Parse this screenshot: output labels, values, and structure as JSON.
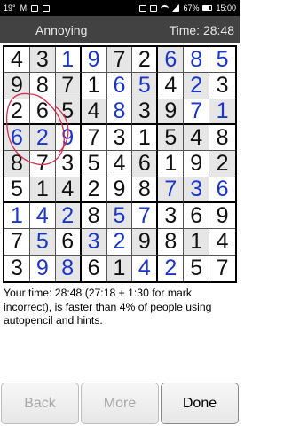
{
  "status_bar": {
    "left_indicators": [
      "19°",
      "M"
    ],
    "battery": "67%",
    "time": "15:00"
  },
  "header": {
    "difficulty": "Annoying",
    "timer": "Time: 28:48"
  },
  "board": {
    "rows": [
      [
        "4",
        "3",
        "1",
        "9",
        "7",
        "2",
        "6",
        "8",
        "5"
      ],
      [
        "9",
        "8",
        "7",
        "1",
        "6",
        "5",
        "4",
        "2",
        "3"
      ],
      [
        "2",
        "6",
        "5",
        "4",
        "8",
        "3",
        "9",
        "7",
        "1"
      ],
      [
        "6",
        "2",
        "9",
        "7",
        "3",
        "1",
        "5",
        "4",
        "8"
      ],
      [
        "8",
        "7",
        "3",
        "5",
        "4",
        "6",
        "1",
        "9",
        "2"
      ],
      [
        "5",
        "1",
        "4",
        "2",
        "9",
        "8",
        "7",
        "3",
        "6"
      ],
      [
        "1",
        "4",
        "2",
        "8",
        "5",
        "7",
        "3",
        "6",
        "9"
      ],
      [
        "7",
        "5",
        "6",
        "3",
        "2",
        "9",
        "8",
        "1",
        "4"
      ],
      [
        "3",
        "9",
        "8",
        "6",
        "1",
        "4",
        "2",
        "5",
        "7"
      ]
    ],
    "colors": [
      [
        "k",
        "k",
        "b",
        "b",
        "k",
        "k",
        "b",
        "b",
        "b"
      ],
      [
        "k",
        "k",
        "k",
        "k",
        "b",
        "b",
        "k",
        "b",
        "k"
      ],
      [
        "k",
        "k",
        "k",
        "k",
        "b",
        "k",
        "k",
        "b",
        "b"
      ],
      [
        "b",
        "b",
        "b",
        "k",
        "k",
        "k",
        "k",
        "k",
        "k"
      ],
      [
        "k",
        "k",
        "k",
        "k",
        "k",
        "k",
        "k",
        "k",
        "k"
      ],
      [
        "k",
        "k",
        "k",
        "k",
        "k",
        "k",
        "b",
        "b",
        "b"
      ],
      [
        "b",
        "b",
        "b",
        "k",
        "b",
        "b",
        "k",
        "k",
        "k"
      ],
      [
        "k",
        "b",
        "k",
        "b",
        "b",
        "k",
        "k",
        "k",
        "k"
      ],
      [
        "k",
        "b",
        "b",
        "k",
        "k",
        "b",
        "b",
        "k",
        "k"
      ]
    ],
    "shaded": [
      [
        0,
        1,
        0,
        0,
        1,
        0,
        1,
        0,
        0
      ],
      [
        1,
        0,
        1,
        0,
        0,
        1,
        0,
        1,
        0
      ],
      [
        0,
        0,
        1,
        1,
        0,
        1,
        1,
        0,
        1
      ],
      [
        1,
        1,
        0,
        0,
        0,
        0,
        1,
        1,
        0
      ],
      [
        1,
        0,
        0,
        0,
        0,
        1,
        0,
        0,
        1
      ],
      [
        0,
        1,
        1,
        0,
        0,
        0,
        1,
        1,
        0
      ],
      [
        0,
        0,
        1,
        0,
        1,
        0,
        0,
        0,
        0
      ],
      [
        0,
        1,
        0,
        1,
        0,
        1,
        0,
        1,
        0
      ],
      [
        0,
        0,
        1,
        0,
        1,
        0,
        0,
        0,
        0
      ]
    ],
    "colors_hex": {
      "given": "#111111",
      "entered": "#1a35c9",
      "scribble": "#d32f4f"
    }
  },
  "result_message": "Your time: 28:48 (27:18 + 1:30 for mark incorrect), is faster than 4% of people using autopencil and hints.",
  "buttons": {
    "back": "Back",
    "more": "More",
    "done": "Done"
  }
}
